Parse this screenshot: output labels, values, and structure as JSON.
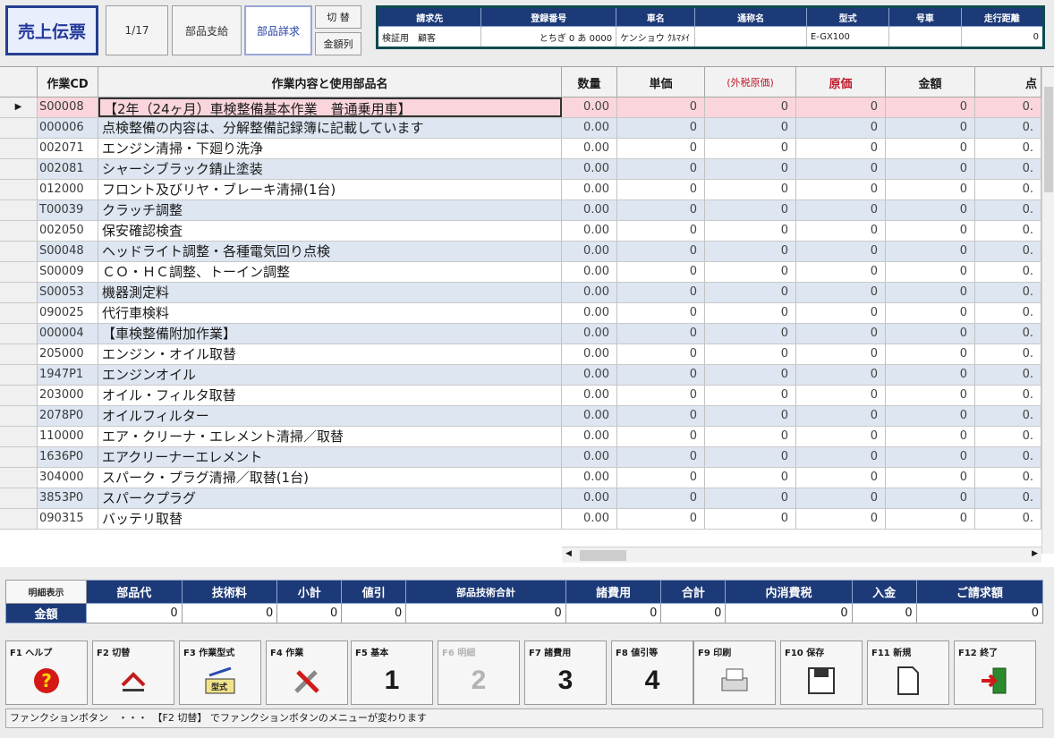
{
  "header": {
    "title": "売上伝票",
    "page": "1/17",
    "parts_btn": "部品支給",
    "parts_sub_btn": "部品詳求",
    "switch_btn": "切 替",
    "all_btn": "金額列",
    "info_columns": [
      "請求先",
      "登録番号",
      "車名",
      "通称名",
      "型式",
      "号車",
      "走行距離"
    ],
    "info_values": [
      "検証用　顧客",
      "とちぎ 0 あ 0000",
      "ケンショウ ｸﾙﾏﾒｲ",
      "",
      "E-GX100",
      "",
      "0"
    ]
  },
  "grid": {
    "columns": [
      "",
      "作業CD",
      "作業内容と使用部品名",
      "数量",
      "単価",
      "(外税原価)",
      "原価",
      "金額",
      "点"
    ],
    "rows": [
      {
        "cd": "S00008",
        "name": "【2年（24ヶ月）車検整備基本作業　普通乗用車】",
        "qty": "0.00",
        "price": "0",
        "tax": "0",
        "cost": "0",
        "amount": "0",
        "pt": "0."
      },
      {
        "cd": "000006",
        "name": "点検整備の内容は、分解整備記録簿に記載しています",
        "qty": "0.00",
        "price": "0",
        "tax": "0",
        "cost": "0",
        "amount": "0",
        "pt": "0."
      },
      {
        "cd": "002071",
        "name": "エンジン清掃・下廻り洗浄",
        "qty": "0.00",
        "price": "0",
        "tax": "0",
        "cost": "0",
        "amount": "0",
        "pt": "0."
      },
      {
        "cd": "002081",
        "name": "シャーシブラック錆止塗装",
        "qty": "0.00",
        "price": "0",
        "tax": "0",
        "cost": "0",
        "amount": "0",
        "pt": "0."
      },
      {
        "cd": "012000",
        "name": "フロント及びリヤ・ブレーキ清掃(1台)",
        "qty": "0.00",
        "price": "0",
        "tax": "0",
        "cost": "0",
        "amount": "0",
        "pt": "0."
      },
      {
        "cd": "T00039",
        "name": "クラッチ調整",
        "qty": "0.00",
        "price": "0",
        "tax": "0",
        "cost": "0",
        "amount": "0",
        "pt": "0."
      },
      {
        "cd": "002050",
        "name": "保安確認検査",
        "qty": "0.00",
        "price": "0",
        "tax": "0",
        "cost": "0",
        "amount": "0",
        "pt": "0."
      },
      {
        "cd": "S00048",
        "name": "ヘッドライト調整・各種電気回り点検",
        "qty": "0.00",
        "price": "0",
        "tax": "0",
        "cost": "0",
        "amount": "0",
        "pt": "0."
      },
      {
        "cd": "S00009",
        "name": "ＣＯ・ＨＣ調整、トーイン調整",
        "qty": "0.00",
        "price": "0",
        "tax": "0",
        "cost": "0",
        "amount": "0",
        "pt": "0."
      },
      {
        "cd": "S00053",
        "name": "機器測定料",
        "qty": "0.00",
        "price": "0",
        "tax": "0",
        "cost": "0",
        "amount": "0",
        "pt": "0."
      },
      {
        "cd": "090025",
        "name": "代行車検料",
        "qty": "0.00",
        "price": "0",
        "tax": "0",
        "cost": "0",
        "amount": "0",
        "pt": "0."
      },
      {
        "cd": "000004",
        "name": "【車検整備附加作業】",
        "qty": "0.00",
        "price": "0",
        "tax": "0",
        "cost": "0",
        "amount": "0",
        "pt": "0."
      },
      {
        "cd": "205000",
        "name": "エンジン・オイル取替",
        "qty": "0.00",
        "price": "0",
        "tax": "0",
        "cost": "0",
        "amount": "0",
        "pt": "0."
      },
      {
        "cd": "1947P1",
        "name": "エンジンオイル",
        "qty": "0.00",
        "price": "0",
        "tax": "0",
        "cost": "0",
        "amount": "0",
        "pt": "0."
      },
      {
        "cd": "203000",
        "name": "オイル・フィルタ取替",
        "qty": "0.00",
        "price": "0",
        "tax": "0",
        "cost": "0",
        "amount": "0",
        "pt": "0."
      },
      {
        "cd": "2078P0",
        "name": "オイルフィルター",
        "qty": "0.00",
        "price": "0",
        "tax": "0",
        "cost": "0",
        "amount": "0",
        "pt": "0."
      },
      {
        "cd": "110000",
        "name": "エア・クリーナ・エレメント清掃／取替",
        "qty": "0.00",
        "price": "0",
        "tax": "0",
        "cost": "0",
        "amount": "0",
        "pt": "0."
      },
      {
        "cd": "1636P0",
        "name": "エアクリーナーエレメント",
        "qty": "0.00",
        "price": "0",
        "tax": "0",
        "cost": "0",
        "amount": "0",
        "pt": "0."
      },
      {
        "cd": "304000",
        "name": "スパーク・プラグ清掃／取替(1台)",
        "qty": "0.00",
        "price": "0",
        "tax": "0",
        "cost": "0",
        "amount": "0",
        "pt": "0."
      },
      {
        "cd": "3853P0",
        "name": "スパークプラグ",
        "qty": "0.00",
        "price": "0",
        "tax": "0",
        "cost": "0",
        "amount": "0",
        "pt": "0."
      },
      {
        "cd": "090315",
        "name": "バッテリ取替",
        "qty": "0.00",
        "price": "0",
        "tax": "0",
        "cost": "0",
        "amount": "0",
        "pt": "0."
      }
    ]
  },
  "totals": {
    "toggle_label": "明細表示",
    "row_label": "金額",
    "columns": [
      "部品代",
      "技術料",
      "小計",
      "値引",
      "部品技術合計",
      "諸費用",
      "合計",
      "内消費税",
      "入金",
      "ご請求額"
    ],
    "values": [
      "0",
      "0",
      "0",
      "0",
      "0",
      "0",
      "0",
      "0",
      "0",
      "0"
    ]
  },
  "fkeys": [
    {
      "label": "F1 ヘルプ",
      "icon": "help-icon"
    },
    {
      "label": "F2 切替",
      "icon": "switch-icon"
    },
    {
      "label": "F3 作業型式",
      "icon": "work-type-icon"
    },
    {
      "label": "F4 作業",
      "icon": "tools-icon"
    },
    {
      "label": "F5 基本",
      "num": "1"
    },
    {
      "label": "F6 明細",
      "num": "2",
      "disabled": true
    },
    {
      "label": "F7 諸費用",
      "num": "3"
    },
    {
      "label": "F8 値引等",
      "num": "4"
    },
    {
      "label": "F9 印刷",
      "icon": "printer-icon"
    },
    {
      "label": "F10 保存",
      "icon": "save-icon"
    },
    {
      "label": "F11 新規",
      "icon": "new-doc-icon"
    },
    {
      "label": "F12 終了",
      "icon": "exit-icon"
    }
  ],
  "status": "ファンクションボタン　・・・　【F2 切替】 でファンクションボタンのメニューが変わります",
  "colors": {
    "header_navy": "#1d3a78",
    "selected_row": "#fad6dc",
    "alt_row": "#dde6f1",
    "red_header": "#c0182a"
  }
}
